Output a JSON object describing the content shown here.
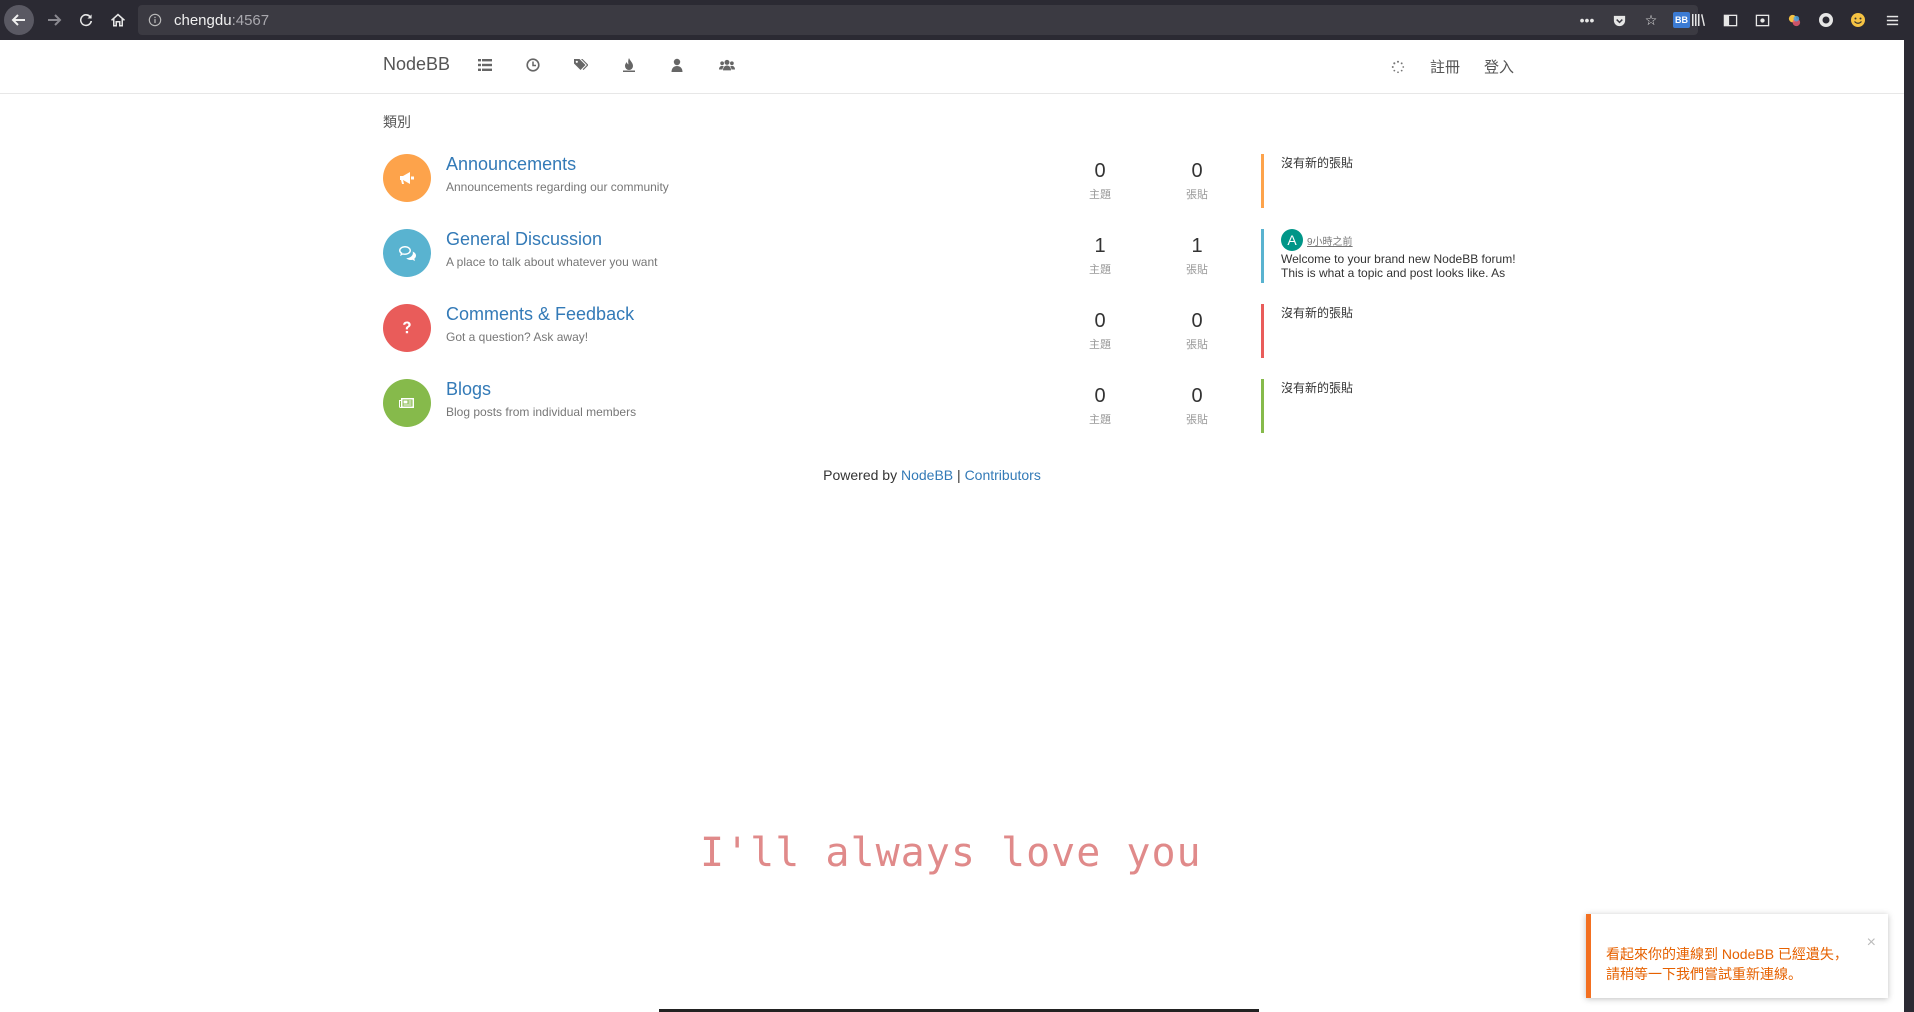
{
  "browser": {
    "url_host": "chengdu",
    "url_port": ":4567",
    "bb_badge": "BB"
  },
  "header": {
    "brand": "NodeBB",
    "register": "註冊",
    "login": "登入"
  },
  "breadcrumb": "類別",
  "categories": [
    {
      "title": "Announcements",
      "description": "Announcements regarding our community",
      "topics": "0",
      "posts": "0",
      "topics_label": "主題",
      "posts_label": "張貼",
      "teaser_empty": "沒有新的張貼",
      "color": "#fda34b",
      "icon": "bullhorn-icon"
    },
    {
      "title": "General Discussion",
      "description": "A place to talk about whatever you want",
      "topics": "1",
      "posts": "1",
      "topics_label": "主題",
      "posts_label": "張貼",
      "teaser_avatar": "A",
      "teaser_time": "9小時之前",
      "teaser_excerpt": "Welcome to your brand new NodeBB forum! This is what a topic and post looks like. As",
      "color": "#59b3d0",
      "icon": "comments-icon"
    },
    {
      "title": "Comments & Feedback",
      "description": "Got a question? Ask away!",
      "topics": "0",
      "posts": "0",
      "topics_label": "主題",
      "posts_label": "張貼",
      "teaser_empty": "沒有新的張貼",
      "color": "#e95c5a",
      "icon": "question-icon"
    },
    {
      "title": "Blogs",
      "description": "Blog posts from individual members",
      "topics": "0",
      "posts": "0",
      "topics_label": "主題",
      "posts_label": "張貼",
      "teaser_empty": "沒有新的張貼",
      "color": "#86ba4b",
      "icon": "newspaper-icon"
    }
  ],
  "footer": {
    "powered_by": "Powered by",
    "nodebb_link": "NodeBB",
    "separator": "|",
    "contributors_link": "Contributors"
  },
  "overlay_text": "I'll always love you",
  "toast": {
    "message": "看起來你的連線到 NodeBB 已經遺失，請稍等一下我們嘗試重新連線。",
    "close": "×"
  }
}
